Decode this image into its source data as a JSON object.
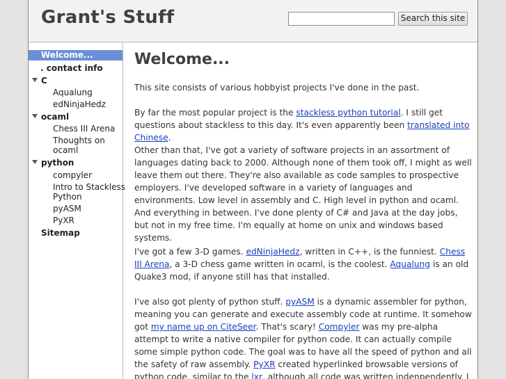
{
  "header": {
    "site_title": "Grant's Stuff",
    "search_placeholder": "",
    "search_button": "Search this site"
  },
  "sidebar": {
    "welcome": "Welcome...",
    "contact": ". contact info",
    "c": "C",
    "aqualung": "Aqualung",
    "ednijahedz": "edNinjaHedz",
    "ocaml": "ocaml",
    "chess": "Chess III Arena",
    "thoughts_line1": "Thoughts on",
    "thoughts_line2": "ocaml",
    "python": "python",
    "compyler": "compyler",
    "stackless_line1": "Intro to Stackless",
    "stackless_line2": "Python",
    "pyasm": "pyASM",
    "pyxr": "PyXR",
    "sitemap": "Sitemap"
  },
  "content": {
    "title": "Welcome...",
    "p1": "This site consists of various hobbyist projects I've done in the past.",
    "p2": {
      "t1": "By far the most popular project is the ",
      "link1": "stackless python tutorial",
      "t2": ".  I still get questions about stackless to this day.  It's even apparently been ",
      "link2": "translated into Chinese",
      "t3": "."
    },
    "p3": "Other than that, I've got a variety of software projects in an assortment of languages dating back to 2000.  Although none of them took off, I might as well leave them out there.  They're also available as code samples to prospective employers.   I've developed software in a variety of languages and environments.  Low level in assembly and C.  High level in python and ocaml.  And everything in between.  I've done plenty of C# and Java at the day jobs, but not in my free time.  I'm equally at home on unix and windows based systems.",
    "p4": {
      "t1": "I've got a few 3-D games.  ",
      "link1": "edNinjaHedz",
      "t2": ", written in C++, is the funniest.  ",
      "link2": "Chess III Arena",
      "t3": ", a 3-D chess game written in ocaml, is the coolest.  ",
      "link3": "Aqualung",
      "t4": " is an old Quake3 mod, if anyone still has that installed."
    },
    "p5": {
      "t1": "I've also got plenty of python stuff.  ",
      "link1": "pyASM",
      "t2": " is a dynamic assembler for python, meaning you can generate and execute assembly code at runtime.  It somehow got ",
      "link2": "my name up on CiteSeer",
      "t3": ".  That's scary!  ",
      "link3": "Compyler",
      "t4": " was my pre-alpha attempt to write a native compiler for python code.  It can actually compile some simple python code.  The goal was to have all the speed of python and all the safety of raw assembly.  ",
      "link4": "PyXR",
      "t5": " created hyperlinked browsable versions of python code, similar to the ",
      "link5": "lxr",
      "t6": ", although all code was written indenpendently.  I thought it was pretty useful"
    }
  },
  "colors": {
    "link": "#1a3fbf",
    "active_nav": "#6b8fd6",
    "title": "#404040"
  }
}
